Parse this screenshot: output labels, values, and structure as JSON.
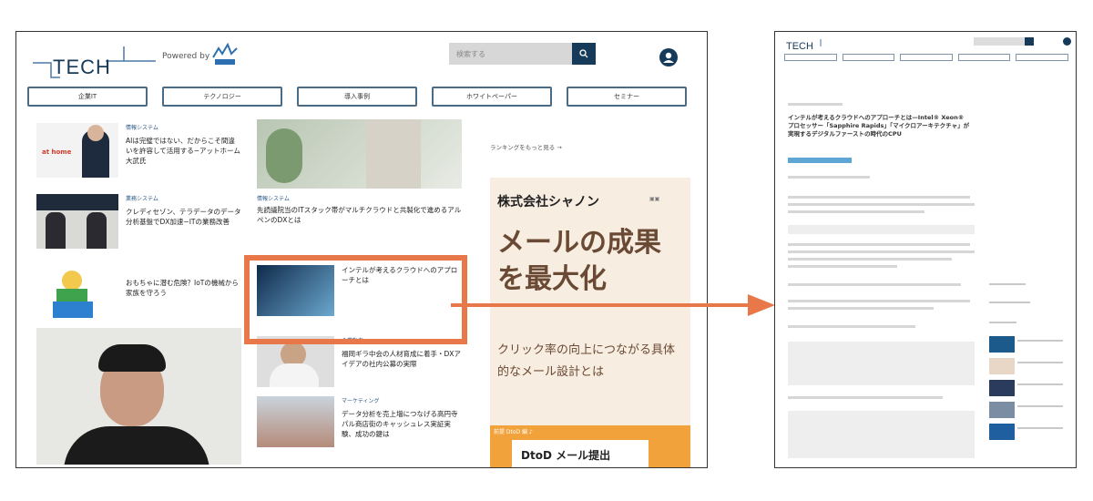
{
  "left_screen": {
    "logo_text": "TECH",
    "powered_by": "Powered by",
    "search_placeholder": "検索する",
    "nav": [
      "企業IT",
      "テクノロジー",
      "導入事例",
      "ホワイトペーパー",
      "セミナー"
    ],
    "col1": [
      {
        "category": "情報システム",
        "title": "AIは完璧ではない、だからこそ間違いを許容して活用する−アットホーム大武氏"
      },
      {
        "category": "業務システム",
        "title": "クレディセゾン、テラデータのデータ分析基盤でDX加速−ITの業務改善"
      },
      {
        "category": "",
        "title": "おもちゃに潜む危険？IoTの機械から家族を守ろう"
      }
    ],
    "col2": [
      {
        "category": "情報システム",
        "title": "先読議院当のITスタック帯がマルチクラウドと共製化で進めるアルペンのDXとは"
      },
      {
        "category": "",
        "title": "インテルが考えるクラウドへのアプローチとは"
      },
      {
        "category": "企業動向",
        "title": "福岡ギラ中会の人材育成に着手・DXアイデアの社内公募の実際"
      },
      {
        "category": "マーケティング",
        "title": "データ分析を売上増につなげる高円寺パル商店街のキャッシュレス実証実験、成功の鍵は"
      }
    ],
    "ranking_link": "ランキングをもっと見る  →",
    "ad": {
      "company": "株式会社シャノン",
      "headline": "メールの成果を最大化",
      "sub": "クリック率の向上につながる具体的なメール設計とは",
      "banner_top": "前提 DtoD 編 ♪",
      "banner_box": "DtoD メール提出"
    }
  },
  "right_screen": {
    "article_title": "インテルが考えるクラウドへのアプローチとは—Intel® Xeon® プロセッサー「Sapphire Rapids」「マイクロアーキテクチャ」が実現するデジタルファーストの時代のCPU"
  },
  "colors": {
    "highlight": "#e8784a",
    "nav_border": "#4a6b86",
    "search_button": "#163a5a",
    "ad_bg": "#f7ede0",
    "ad_text": "#6b4a35"
  }
}
